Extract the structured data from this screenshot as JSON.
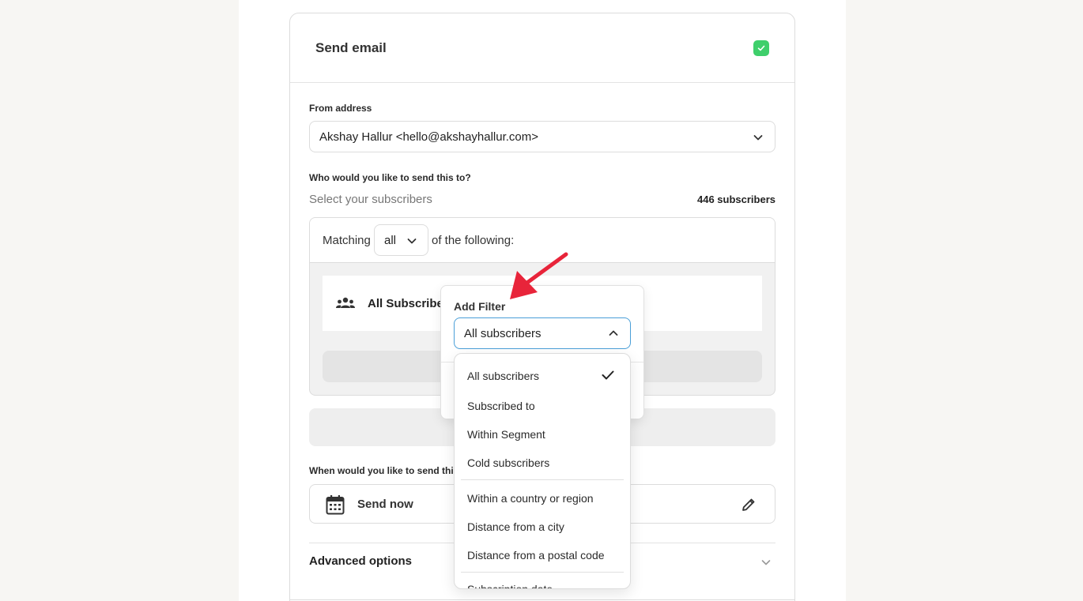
{
  "card": {
    "title": "Send email"
  },
  "from": {
    "label": "From address",
    "value": "Akshay Hallur <hello@akshayhallur.com>"
  },
  "recipients": {
    "label": "Who would you like to send this to?",
    "helper": "Select your subscribers",
    "count": "446 subscribers",
    "matching_label": "Matching",
    "matching_value": "all",
    "of_following": "of the following:",
    "condition_label": "All Subscribers"
  },
  "popover": {
    "title": "Add Filter",
    "selected": "All subscribers"
  },
  "menu": {
    "group1": [
      {
        "label": "All subscribers",
        "checked": true
      },
      {
        "label": "Subscribed to"
      },
      {
        "label": "Within Segment"
      },
      {
        "label": "Cold subscribers"
      }
    ],
    "group2": [
      {
        "label": "Within a country or region"
      },
      {
        "label": "Distance from a city"
      },
      {
        "label": "Distance from a postal code"
      }
    ],
    "group3": [
      {
        "label": "Subscription date"
      }
    ]
  },
  "schedule": {
    "label": "When would you like to send this?",
    "value": "Send now"
  },
  "advanced": {
    "label": "Advanced options"
  },
  "colors": {
    "accent_green": "#3ecf6b",
    "focus_blue": "#4a9fd8",
    "annotation_red": "#e8243a"
  }
}
